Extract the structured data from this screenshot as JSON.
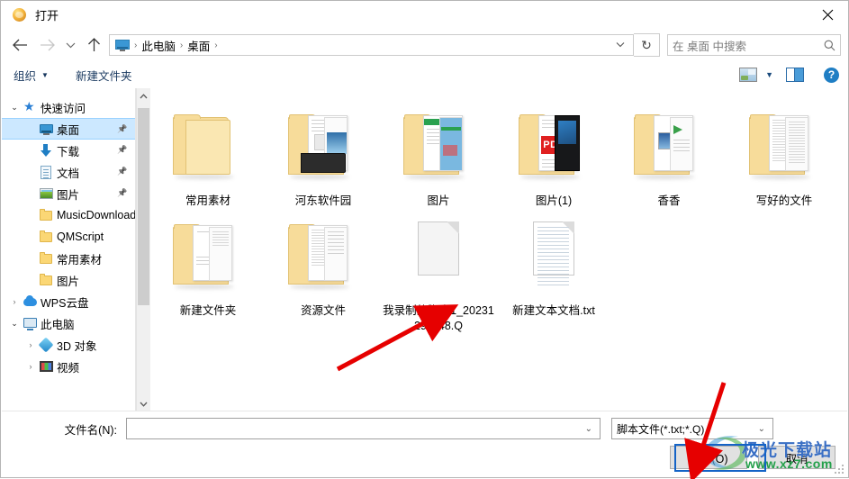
{
  "window": {
    "title": "打开",
    "title_icon": "open-folder-globe-icon",
    "close_label": "×"
  },
  "nav": {
    "back_icon": "arrow-left-icon",
    "forward_icon": "arrow-right-icon",
    "recent_icon": "chevron-down-icon",
    "up_icon": "arrow-up-icon",
    "address_icon": "this-pc-icon",
    "breadcrumbs": [
      "此电脑",
      "桌面"
    ],
    "separator": "›",
    "address_dropdown_icon": "chevron-down-icon",
    "refresh_icon": "refresh-icon",
    "refresh_glyph": "↻"
  },
  "search": {
    "placeholder": "在 桌面 中搜索",
    "icon": "search-icon"
  },
  "commandbar": {
    "organize_label": "组织",
    "organize_caret": "▼",
    "new_folder_label": "新建文件夹",
    "view_icon": "view-layout-icon",
    "view_caret": "▼",
    "preview_pane_icon": "preview-pane-icon",
    "help_icon": "help-icon",
    "help_glyph": "?"
  },
  "sidebar": {
    "scroll_up_glyph": "︿",
    "scroll_down_glyph": "﹀",
    "items": [
      {
        "label": "快速访问",
        "icon": "star-icon",
        "chevron": "⌄",
        "indent": 0,
        "selected": false,
        "pinned": false
      },
      {
        "label": "桌面",
        "icon": "desktop-icon",
        "chevron": "",
        "indent": 1,
        "selected": true,
        "pinned": true
      },
      {
        "label": "下载",
        "icon": "download-icon",
        "chevron": "",
        "indent": 1,
        "selected": false,
        "pinned": true
      },
      {
        "label": "文档",
        "icon": "documents-icon",
        "chevron": "",
        "indent": 1,
        "selected": false,
        "pinned": true
      },
      {
        "label": "图片",
        "icon": "pictures-icon",
        "chevron": "",
        "indent": 1,
        "selected": false,
        "pinned": true
      },
      {
        "label": "MusicDownload",
        "icon": "folder-icon",
        "chevron": "",
        "indent": 1,
        "selected": false,
        "pinned": false
      },
      {
        "label": "QMScript",
        "icon": "folder-icon",
        "chevron": "",
        "indent": 1,
        "selected": false,
        "pinned": false
      },
      {
        "label": "常用素材",
        "icon": "folder-icon",
        "chevron": "",
        "indent": 1,
        "selected": false,
        "pinned": false
      },
      {
        "label": "图片",
        "icon": "folder-icon",
        "chevron": "",
        "indent": 1,
        "selected": false,
        "pinned": false
      },
      {
        "label": "WPS云盘",
        "icon": "cloud-icon",
        "chevron": "›",
        "indent": 0,
        "selected": false,
        "pinned": false
      },
      {
        "label": "此电脑",
        "icon": "this-pc-icon",
        "chevron": "⌄",
        "indent": 0,
        "selected": false,
        "pinned": false
      },
      {
        "label": "3D 对象",
        "icon": "3d-objects-icon",
        "chevron": "›",
        "indent": 1,
        "selected": false,
        "pinned": false
      },
      {
        "label": "视频",
        "icon": "videos-icon",
        "chevron": "›",
        "indent": 1,
        "selected": false,
        "pinned": false
      }
    ]
  },
  "files": {
    "rows": [
      [
        {
          "name": "常用素材",
          "type": "folder-plain"
        },
        {
          "name": "河东软件园",
          "type": "folder-docs"
        },
        {
          "name": "图片",
          "type": "folder-green"
        },
        {
          "name": "图片(1)",
          "type": "folder-pdf"
        },
        {
          "name": "香香",
          "type": "folder-media"
        },
        {
          "name": "写好的文件",
          "type": "folder-text"
        }
      ],
      [
        {
          "name": "新建文件夹",
          "type": "folder-sketch"
        },
        {
          "name": "资源文件",
          "type": "folder-list"
        },
        {
          "name": "我录制的脚本1_20231291148.Q",
          "type": "file-blank"
        },
        {
          "name": "新建文本文档.txt",
          "type": "file-txt"
        }
      ]
    ],
    "pdf_badge": "PDF"
  },
  "bottom": {
    "filename_label": "文件名(N):",
    "filename_value": "",
    "filename_placeholder": "",
    "filename_caret": "⌄",
    "filter_value": "脚本文件(*.txt;*.Q)",
    "filter_caret": "⌄",
    "open_button": "打开(O)",
    "cancel_button": "取消"
  },
  "annotations": {
    "highlight_color": "#1463c6",
    "arrow_color": "#e60000",
    "arrow_count": 2
  },
  "watermark": {
    "text": "极光下载站",
    "url": "www.xz7.com",
    "text_color": "#3a6fc4",
    "url_color": "#23a04a"
  }
}
